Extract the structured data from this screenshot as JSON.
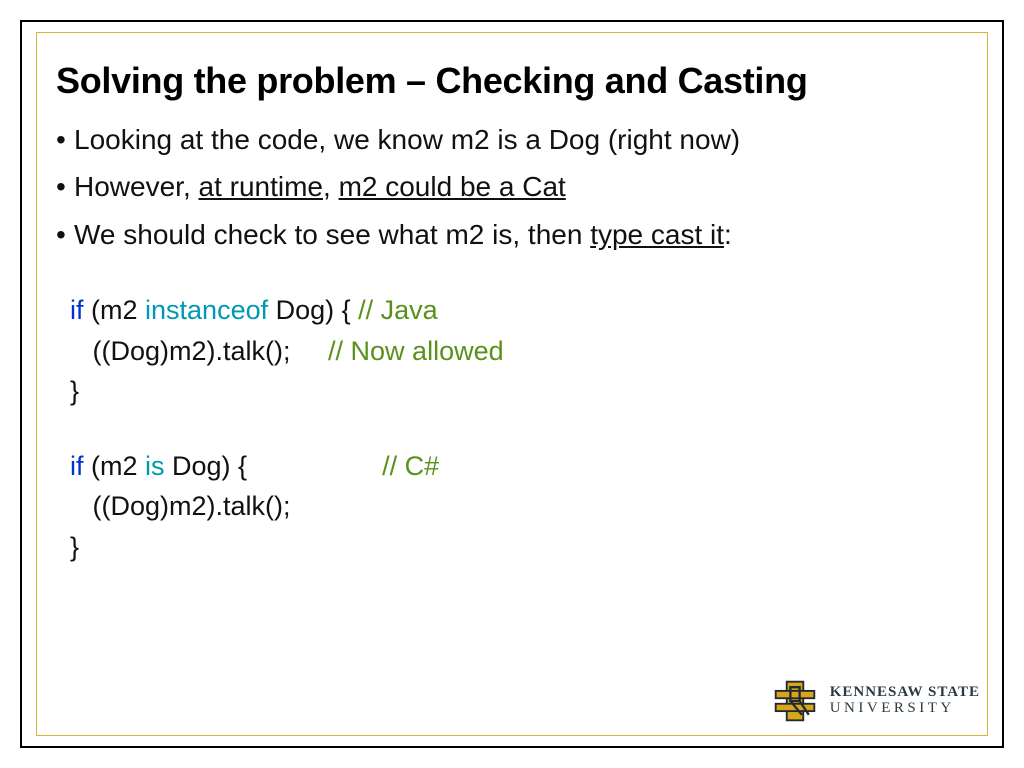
{
  "title": "Solving the problem – Checking and Casting",
  "bullets": {
    "b1": "Looking at the code, we know m2 is a Dog (right now)",
    "b2_prefix": "However, ",
    "b2_u1": "at runtime",
    "b2_mid": ", ",
    "b2_u2": "m2 could be a Cat",
    "b3_prefix": "We should check to see what m2 is, then ",
    "b3_u1": "type cast it",
    "b3_suffix": ":"
  },
  "code": {
    "java": {
      "if": "if",
      "open": " (m2 ",
      "instanceof": "instanceof",
      "rest": " Dog) { ",
      "comment1": "// Java",
      "line2": "   ((Dog)m2).talk();     ",
      "comment2": "// Now allowed",
      "close": "}"
    },
    "csharp": {
      "if": "if",
      "open": " (m2 ",
      "is": "is",
      "rest": " Dog) {                  ",
      "comment1": "// C#",
      "line2": "   ((Dog)m2).talk();",
      "close": "}"
    }
  },
  "logo": {
    "line1": "KENNESAW STATE",
    "line2": "UNIVERSITY"
  }
}
